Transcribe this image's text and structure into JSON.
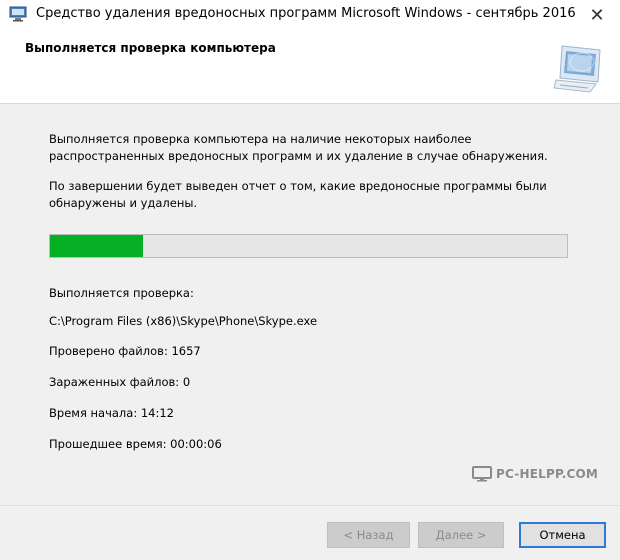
{
  "window": {
    "title": "Средство удаления вредоносных программ Microsoft Windows -  сентябрь 2016",
    "close_glyph": "✕",
    "app_icon": "msrt-app-icon"
  },
  "header": {
    "title": "Выполняется проверка компьютера",
    "graphic_icon": "computer-scan-graphic"
  },
  "body": {
    "description_1": "Выполняется проверка компьютера на наличие некоторых наиболее распространенных вредоносных программ и их удаление в случае обнаружения.",
    "description_2": "По завершении будет выведен отчет о том, какие вредоносные программы были обнаружены и удалены.",
    "progress_fraction": 0.18,
    "progress_color": "#06b025",
    "scanning_label": "Выполняется проверка:",
    "scanning_path": "C:\\Program Files (x86)\\Skype\\Phone\\Skype.exe",
    "scanned_files": "Проверено файлов: 1657",
    "infected_files": "Зараженных файлов: 0",
    "start_time": "Время начала: 14:12",
    "elapsed_time": "Прошедшее время: 00:00:06"
  },
  "watermark": {
    "text": "PC-HELPP.COM",
    "icon": "monitor-icon"
  },
  "buttons": {
    "back": "< Назад",
    "next": "Далее >",
    "cancel": "Отмена"
  }
}
